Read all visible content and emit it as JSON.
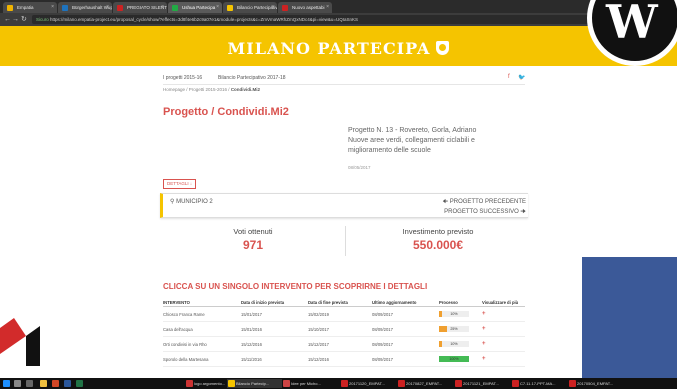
{
  "browser": {
    "tabs": [
      {
        "label": "Empatia",
        "color": "#f0b400",
        "active": false
      },
      {
        "label": "Bürgerhaushalt Wuppertal",
        "color": "#1e73be",
        "active": false
      },
      {
        "label": "PREGIATO SILENT",
        "color": "#cc2222",
        "active": false
      },
      {
        "label": "Ushua Partecipa",
        "color": "#22aa44",
        "active": true
      },
      {
        "label": "Bilancio Partecipativo",
        "color": "#f5c400",
        "active": false
      },
      {
        "label": "Nuovo aspettabi",
        "color": "#cc2222",
        "active": false
      }
    ],
    "secure_label": "Sicuro",
    "url": "https://milano.empatia-project.eu/proposal_cycle/show/?effects=3d8f4e6b2c9a07e1&module=projects&c=ZmVmaWRhZmQxNDc4&pi=view&u=UQIaSnKS"
  },
  "site": {
    "title": "MILANO PARTECIPA"
  },
  "subnav": {
    "items": [
      "I progetti 2015-16",
      "Bilancio Partecipativo 2017-18"
    ],
    "facebook": "f",
    "twitter": "t"
  },
  "breadcrumb": {
    "path": "Homepage / Progetti 2015-2016 /",
    "current": "Condividi.Mi2"
  },
  "project": {
    "title": "Progetto / Condividi.Mi2",
    "info_line1": "Progetto N. 13 - Rovereto, Gorla, Adriano",
    "info_line2": "Nuove aree verdi, collegamenti ciclabili e",
    "info_line3": "miglioramento delle scuole",
    "date": "08/05/2017",
    "details_button": "DETTAGLI ↓",
    "municipio": "MUNICIPIO 2",
    "prev_link": "PROGETTO PRECEDENTE",
    "next_link": "PROGETTO SUCCESSIVO"
  },
  "stats": {
    "votes_label": "Voti ottenuti",
    "votes_value": "971",
    "investment_label": "Investimento previsto",
    "investment_value": "550.000€"
  },
  "interventions": {
    "title": "CLICCA SU UN SINGOLO INTERVENTO PER SCOPRIRNE I DETTAGLI",
    "headers": [
      "INTERVENTO",
      "Data di inizio prevista",
      "Data di fine prevista",
      "Ultimo aggiornamento",
      "Processo",
      "Visualizzare di più"
    ],
    "rows": [
      {
        "name": "Chiosco Franca Rame",
        "start": "15/01/2017",
        "end": "15/02/2019",
        "updated": "08/09/2017",
        "progress_label": "10%",
        "progress": 0.1,
        "color": "#f0a030"
      },
      {
        "name": "Casa dell'acqua",
        "start": "15/01/2016",
        "end": "15/10/2017",
        "updated": "08/09/2017",
        "progress_label": "25%",
        "progress": 0.25,
        "color": "#f0a030"
      },
      {
        "name": "Orti condivisi in via Rho",
        "start": "15/12/2016",
        "end": "15/12/2017",
        "updated": "08/09/2017",
        "progress_label": "10%",
        "progress": 0.1,
        "color": "#f0a030"
      },
      {
        "name": "Sporolo della Martesana",
        "start": "15/11/2016",
        "end": "15/12/2016",
        "updated": "08/09/2017",
        "progress_label": "100%",
        "progress": 1.0,
        "color": "#44bb55"
      }
    ],
    "more_symbol": "+"
  },
  "taskbar": {
    "items": [
      {
        "label": "logo argomento...",
        "color": "#cc3333"
      },
      {
        "label": "Bilancio Partecip...",
        "color": "#f5c400"
      },
      {
        "label": "Idee per Micho...",
        "color": "#cc4444"
      },
      {
        "label": "20171120_EMPAT...",
        "color": "#cc2222"
      },
      {
        "label": "20170827_EMPAT...",
        "color": "#cc2222"
      },
      {
        "label": "20171121_EMPAT...",
        "color": "#cc2222"
      },
      {
        "label": "C7.11.17-PPT-MA...",
        "color": "#cc2222"
      },
      {
        "label": "20170504_EMPAT...",
        "color": "#cc2222"
      }
    ]
  }
}
